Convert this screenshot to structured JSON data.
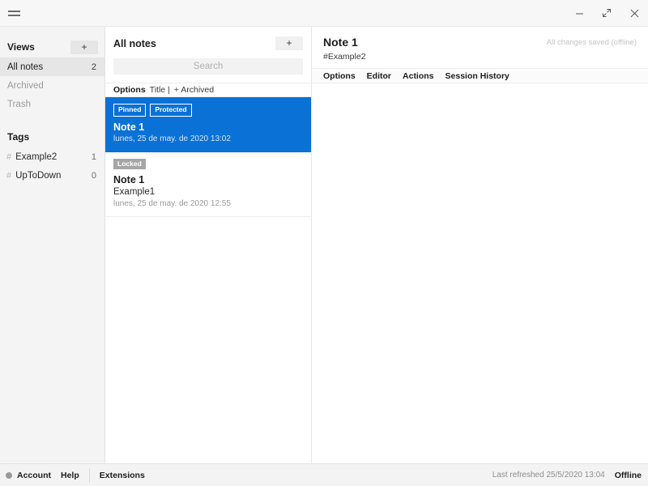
{
  "window": {
    "menu_icon": "hamburger-icon",
    "minimize_label": "–",
    "maximize_label": "maximize-icon",
    "close_label": "×"
  },
  "sidebar": {
    "views": {
      "title": "Views",
      "add_label": "+",
      "items": [
        {
          "label": "All notes",
          "count": "2",
          "active": true
        },
        {
          "label": "Archived",
          "count": "",
          "active": false
        },
        {
          "label": "Trash",
          "count": "",
          "active": false
        }
      ]
    },
    "tags": {
      "title": "Tags",
      "items": [
        {
          "hash": "#",
          "label": "Example2",
          "count": "1"
        },
        {
          "hash": "#",
          "label": "UpToDown",
          "count": "0"
        }
      ]
    }
  },
  "notelist": {
    "title": "All notes",
    "add_label": "+",
    "search": {
      "value": "",
      "placeholder": "Search"
    },
    "options_bar": {
      "options_label": "Options",
      "sort_label": "Title |",
      "archived_label": "+ Archived"
    },
    "notes": [
      {
        "title": "Note 1",
        "preview": "",
        "date": "lunes, 25 de may. de 2020 13:02",
        "badges": [
          {
            "label": "Pinned",
            "style": "outline"
          },
          {
            "label": "Protected",
            "style": "outline"
          }
        ],
        "selected": true
      },
      {
        "title": "Note 1",
        "preview": "Example1",
        "date": "lunes, 25 de may. de 2020 12:55",
        "badges": [
          {
            "label": "Locked",
            "style": "solid"
          }
        ],
        "selected": false
      }
    ]
  },
  "editor": {
    "title": "Note 1",
    "subtitle": "#Example2",
    "status": "All changes saved (offline)",
    "tabs": [
      {
        "label": "Options"
      },
      {
        "label": "Editor"
      },
      {
        "label": "Actions"
      },
      {
        "label": "Session History"
      }
    ],
    "content": ""
  },
  "footer": {
    "account_label": "Account",
    "help_label": "Help",
    "extensions_label": "Extensions",
    "last_refreshed": "Last refreshed 25/5/2020 13:04",
    "connection_label": "Offline"
  },
  "colors": {
    "accent": "#0a71d6",
    "sidebar_bg": "#f4f4f4",
    "badge_solid": "#a6a6a6",
    "status_dot": "#9a9a9a"
  }
}
